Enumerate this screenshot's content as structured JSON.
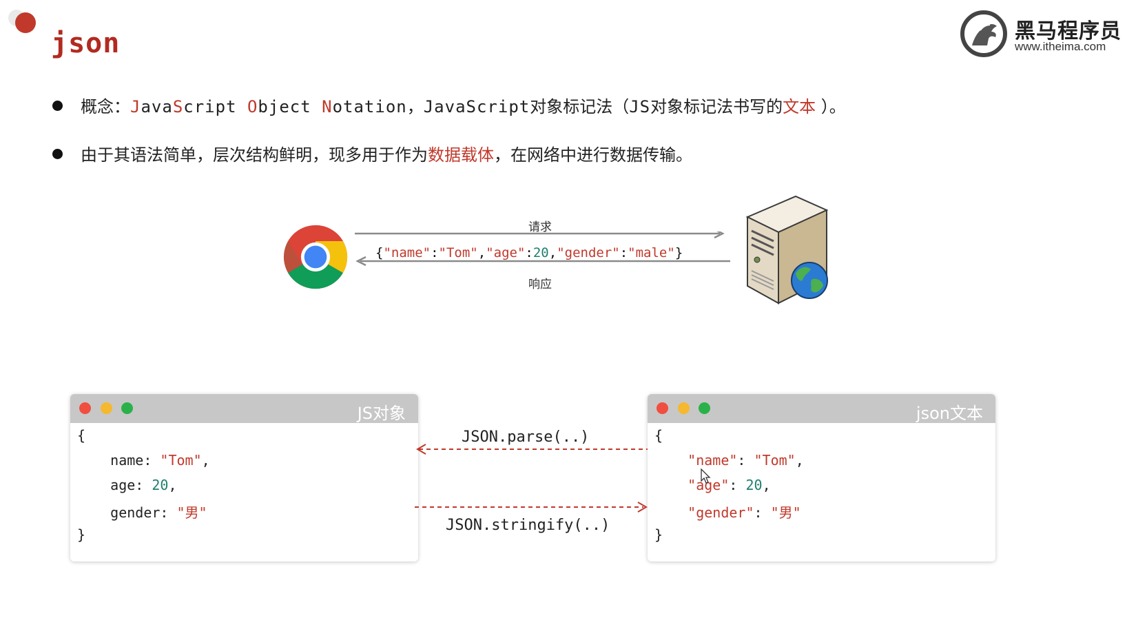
{
  "header": {
    "title": "json",
    "logo_cn": "黑马程序员",
    "logo_url": "www.itheima.com"
  },
  "bullets": [
    {
      "segments": [
        {
          "text": "概念：",
          "style": "normal"
        },
        {
          "text": "J",
          "style": "mono-red"
        },
        {
          "text": "ava",
          "style": "mono"
        },
        {
          "text": "S",
          "style": "mono-red"
        },
        {
          "text": "cript ",
          "style": "mono"
        },
        {
          "text": "O",
          "style": "mono-red"
        },
        {
          "text": "bject ",
          "style": "mono"
        },
        {
          "text": "N",
          "style": "mono-red"
        },
        {
          "text": "otation",
          "style": "mono"
        },
        {
          "text": "，",
          "style": "normal"
        },
        {
          "text": "JavaScript",
          "style": "mono"
        },
        {
          "text": "对象标记法（",
          "style": "normal"
        },
        {
          "text": "JS",
          "style": "mono"
        },
        {
          "text": "对象标记法书写的",
          "style": "normal"
        },
        {
          "text": "文本",
          "style": "red"
        },
        {
          "text": " ）。",
          "style": "normal"
        }
      ]
    },
    {
      "segments": [
        {
          "text": "由于其语法简单，层次结构鲜明，现多用于作为",
          "style": "normal"
        },
        {
          "text": "数据载体",
          "style": "red"
        },
        {
          "text": "，在网络中进行数据传输。",
          "style": "normal"
        }
      ]
    }
  ],
  "diagram": {
    "request_label": "请求",
    "response_label": "响应",
    "payload": [
      {
        "t": "{",
        "c": "p"
      },
      {
        "t": "\"name\"",
        "c": "s"
      },
      {
        "t": ":",
        "c": "p"
      },
      {
        "t": "\"Tom\"",
        "c": "s"
      },
      {
        "t": ",",
        "c": "p"
      },
      {
        "t": "\"age\"",
        "c": "s"
      },
      {
        "t": ":",
        "c": "p"
      },
      {
        "t": "20",
        "c": "n"
      },
      {
        "t": ",",
        "c": "p"
      },
      {
        "t": "\"gender\"",
        "c": "s"
      },
      {
        "t": ":",
        "c": "p"
      },
      {
        "t": "\"male\"",
        "c": "s"
      },
      {
        "t": "}",
        "c": "p"
      }
    ]
  },
  "cards": {
    "left": {
      "title": "JS对象",
      "lines": [
        [
          {
            "t": "{",
            "c": "p"
          }
        ],
        [
          {
            "t": "    name: ",
            "c": "p"
          },
          {
            "t": "\"Tom\"",
            "c": "s"
          },
          {
            "t": ",",
            "c": "p"
          }
        ],
        [
          {
            "t": "    age: ",
            "c": "p"
          },
          {
            "t": "20",
            "c": "n"
          },
          {
            "t": ",",
            "c": "p"
          }
        ],
        [
          {
            "t": "    gender: ",
            "c": "p"
          },
          {
            "t": "\"男\"",
            "c": "s"
          }
        ],
        [
          {
            "t": "}",
            "c": "p"
          }
        ]
      ]
    },
    "right": {
      "title": "json文本",
      "lines": [
        [
          {
            "t": "{",
            "c": "p"
          }
        ],
        [
          {
            "t": "    \"name\"",
            "c": "s"
          },
          {
            "t": ": ",
            "c": "p"
          },
          {
            "t": "\"Tom\"",
            "c": "s"
          },
          {
            "t": ",",
            "c": "p"
          }
        ],
        [
          {
            "t": "    \"age\"",
            "c": "s"
          },
          {
            "t": ": ",
            "c": "p"
          },
          {
            "t": "20",
            "c": "n"
          },
          {
            "t": ",",
            "c": "p"
          }
        ],
        [
          {
            "t": "    \"gender\"",
            "c": "s"
          },
          {
            "t": ": ",
            "c": "p"
          },
          {
            "t": "\"男\"",
            "c": "s"
          }
        ],
        [
          {
            "t": "}",
            "c": "p"
          }
        ]
      ]
    }
  },
  "methods": {
    "parse": "JSON.parse(..)",
    "stringify": "JSON.stringify(..)"
  },
  "colors": {
    "accent_red": "#c0392b",
    "number_teal": "#1e7f6e",
    "arrow_gray": "#8a8a8a",
    "dash_red": "#c0392b"
  }
}
